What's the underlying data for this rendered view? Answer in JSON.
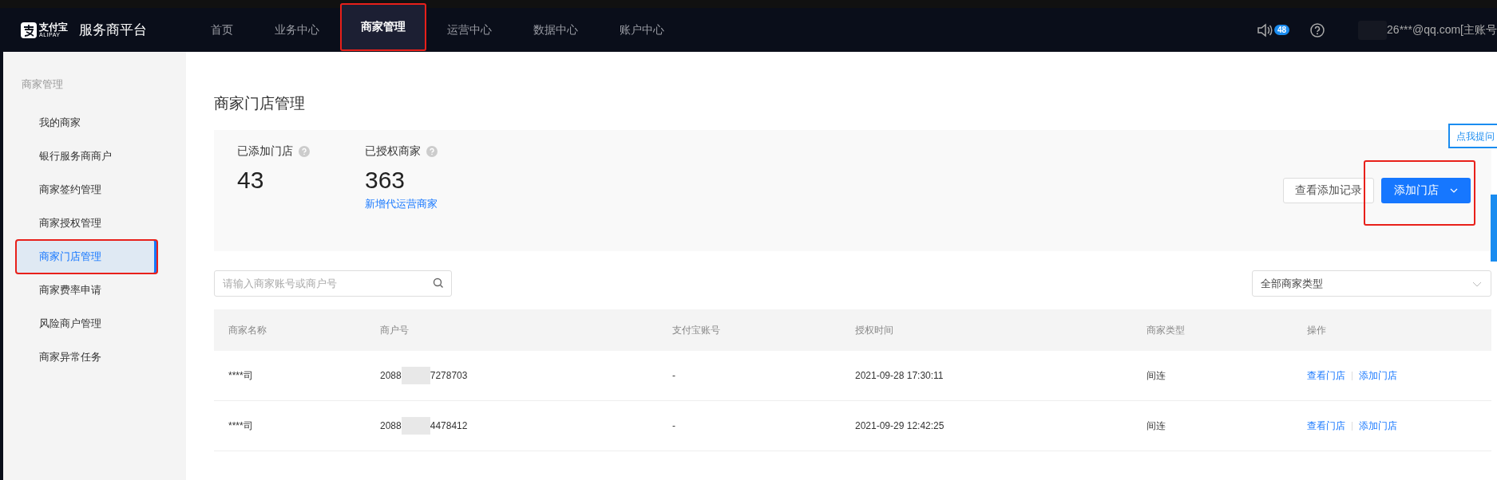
{
  "brand": {
    "logo_text": "支付宝",
    "logo_sub": "ALIPAY",
    "title": "服务商平台"
  },
  "nav": [
    {
      "label": "首页",
      "selected": false,
      "highlighted": false
    },
    {
      "label": "业务中心",
      "selected": false,
      "highlighted": false
    },
    {
      "label": "商家管理",
      "selected": true,
      "highlighted": true
    },
    {
      "label": "运营中心",
      "selected": false,
      "highlighted": false
    },
    {
      "label": "数据中心",
      "selected": false,
      "highlighted": false
    },
    {
      "label": "账户中心",
      "selected": false,
      "highlighted": false
    }
  ],
  "notifications": {
    "count": "48"
  },
  "account": {
    "name": "26***@qq.com[主账号"
  },
  "sidebar": {
    "group": "商家管理",
    "items": [
      {
        "label": "我的商家",
        "selected": false,
        "highlighted": false
      },
      {
        "label": "银行服务商商户",
        "selected": false,
        "highlighted": false
      },
      {
        "label": "商家签约管理",
        "selected": false,
        "highlighted": false
      },
      {
        "label": "商家授权管理",
        "selected": false,
        "highlighted": false
      },
      {
        "label": "商家门店管理",
        "selected": true,
        "highlighted": true
      },
      {
        "label": "商家费率申请",
        "selected": false,
        "highlighted": false
      },
      {
        "label": "风险商户管理",
        "selected": false,
        "highlighted": false
      },
      {
        "label": "商家异常任务",
        "selected": false,
        "highlighted": false
      }
    ]
  },
  "page_title": "商家门店管理",
  "stats": [
    {
      "label": "已添加门店",
      "value": "43"
    },
    {
      "label": "已授权商家",
      "value": "363",
      "link": "新增代运营商家"
    }
  ],
  "actions": {
    "secondary": "查看添加记录",
    "primary": "添加门店",
    "primary_highlighted": true
  },
  "help_tab": "点我提问",
  "search": {
    "placeholder": "请输入商家账号或商户号"
  },
  "type_filter": {
    "value": "全部商家类型"
  },
  "table": {
    "columns": [
      "商家名称",
      "商户号",
      "支付宝账号",
      "授权时间",
      "商家类型",
      "操作"
    ],
    "rows": [
      {
        "name": "****司",
        "merchant_prefix": "2088",
        "merchant_suffix": "7278703",
        "alipay_account": "-",
        "auth_time": "2021-09-28 17:30:11",
        "type": "间连",
        "actions": [
          "查看门店",
          "添加门店"
        ]
      },
      {
        "name": "****司",
        "merchant_prefix": "2088",
        "merchant_suffix": "4478412",
        "alipay_account": "-",
        "auth_time": "2021-09-29 12:42:25",
        "type": "间连",
        "actions": [
          "查看门店",
          "添加门店"
        ]
      }
    ]
  }
}
